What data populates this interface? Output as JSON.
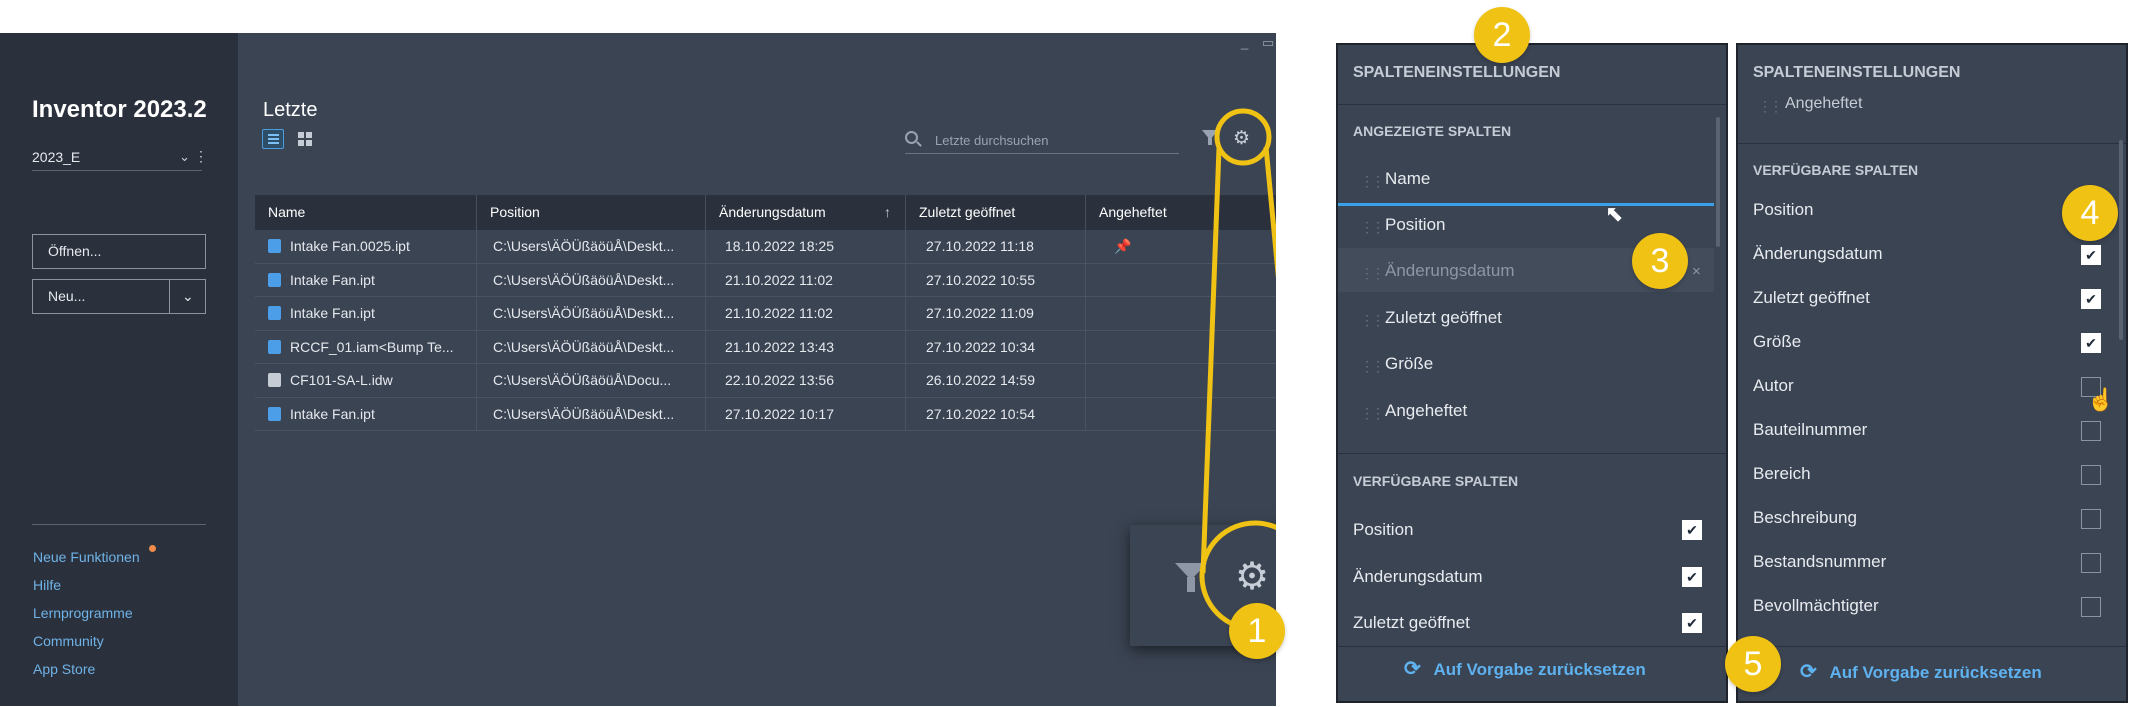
{
  "app": {
    "title": "Inventor 2023.2",
    "version": "2023_E",
    "open_label": "Öffnen...",
    "new_label": "Neu...",
    "window_controls": [
      "_",
      "▭"
    ],
    "links": [
      "Neue Funktionen",
      "Hilfe",
      "Lernprogramme",
      "Community",
      "App Store"
    ],
    "new_features_dot_color": "#f08a4b"
  },
  "main": {
    "title": "Letzte",
    "search_placeholder": "Letzte durchsuchen",
    "columns": [
      "Name",
      "Position",
      "Änderungsdatum",
      "Zuletzt geöffnet",
      "Angeheftet"
    ],
    "sort_column": "Änderungsdatum",
    "rows": [
      {
        "name": "Intake Fan.0025.ipt",
        "position": "C:\\Users\\ÄÖÜßäöüÅ\\Deskt...",
        "modified": "18.10.2022 18:25",
        "opened": "27.10.2022 11:18",
        "pinned": true,
        "icon": "part-icon"
      },
      {
        "name": "Intake Fan.ipt",
        "position": "C:\\Users\\ÄÖÜßäöüÅ\\Deskt...",
        "modified": "21.10.2022 11:02",
        "opened": "27.10.2022 10:55",
        "pinned": false,
        "icon": "part-icon"
      },
      {
        "name": "Intake Fan.ipt",
        "position": "C:\\Users\\ÄÖÜßäöüÅ\\Deskt...",
        "modified": "21.10.2022 11:02",
        "opened": "27.10.2022 11:09",
        "pinned": false,
        "icon": "part-icon"
      },
      {
        "name": "RCCF_01.iam<Bump Te...",
        "position": "C:\\Users\\ÄÖÜßäöüÅ\\Deskt...",
        "modified": "21.10.2022 13:43",
        "opened": "27.10.2022 10:34",
        "pinned": false,
        "icon": "assembly-icon"
      },
      {
        "name": "CF101-SA-L.idw",
        "position": "C:\\Users\\ÄÖÜßäöüÅ\\Docu...",
        "modified": "22.10.2022 13:56",
        "opened": "26.10.2022 14:59",
        "pinned": false,
        "icon": "drawing-icon"
      },
      {
        "name": "Intake Fan.ipt",
        "position": "C:\\Users\\ÄÖÜßäöüÅ\\Deskt...",
        "modified": "27.10.2022 10:17",
        "opened": "27.10.2022 10:54",
        "pinned": false,
        "icon": "part-icon"
      }
    ]
  },
  "panel1": {
    "title": "SPALTENEINSTELLUNGEN",
    "shown_header": "ANGEZEIGTE SPALTEN",
    "shown_columns": [
      "Name",
      "Position",
      "Änderungsdatum",
      "Zuletzt geöffnet",
      "Größe",
      "Angeheftet"
    ],
    "available_header": "VERFÜGBARE SPALTEN",
    "available": [
      {
        "label": "Position",
        "checked": true
      },
      {
        "label": "Änderungsdatum",
        "checked": true
      },
      {
        "label": "Zuletzt geöffnet",
        "checked": true
      }
    ],
    "reset_label": "Auf Vorgabe zurücksetzen"
  },
  "panel2": {
    "title": "SPALTENEINSTELLUNGEN",
    "scrolled_item": "Angeheftet",
    "available_header": "VERFÜGBARE SPALTEN",
    "available": [
      {
        "label": "Position",
        "checked": false,
        "has_checkbox": false
      },
      {
        "label": "Änderungsdatum",
        "checked": true,
        "has_checkbox": true
      },
      {
        "label": "Zuletzt geöffnet",
        "checked": true,
        "has_checkbox": true
      },
      {
        "label": "Größe",
        "checked": true,
        "has_checkbox": true
      },
      {
        "label": "Autor",
        "checked": false,
        "has_checkbox": true
      },
      {
        "label": "Bauteilnummer",
        "checked": false,
        "has_checkbox": true
      },
      {
        "label": "Bereich",
        "checked": false,
        "has_checkbox": true
      },
      {
        "label": "Beschreibung",
        "checked": false,
        "has_checkbox": true
      },
      {
        "label": "Bestandsnummer",
        "checked": false,
        "has_checkbox": true
      },
      {
        "label": "Bevollmächtigter",
        "checked": false,
        "has_checkbox": true
      }
    ],
    "reset_label": "Auf Vorgabe zurücksetzen"
  },
  "callouts": [
    "1",
    "2",
    "3",
    "4",
    "5"
  ],
  "colors": {
    "accent": "#f0c214",
    "link": "#5fb2f0",
    "pin": "#3fa2ea",
    "drag_line": "#3aa0e8"
  }
}
